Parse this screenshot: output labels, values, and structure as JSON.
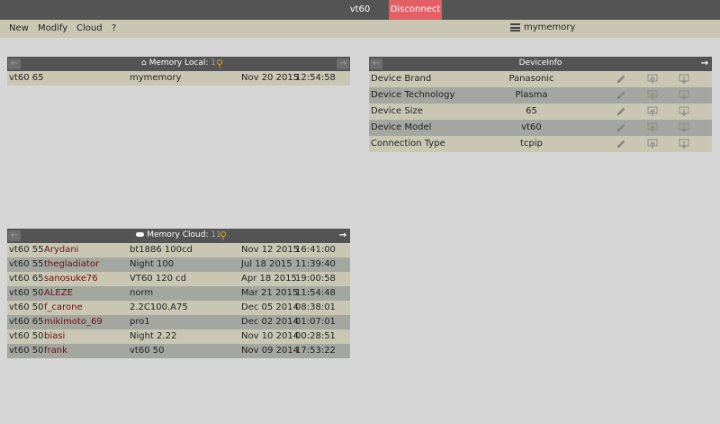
{
  "window": {
    "title": "vt60",
    "disconnect_label": "Disconnect"
  },
  "menu": {
    "items": [
      "New",
      "Modify",
      "Cloud",
      "?"
    ],
    "memory_name": "mymemory"
  },
  "memory_local": {
    "title": "Memory Local:",
    "count": "1",
    "rows": [
      {
        "model": "vt60 65",
        "name": "mymemory",
        "date": "Nov 20 2015",
        "time": "12:54:58"
      }
    ]
  },
  "memory_cloud": {
    "title": "Memory Cloud:",
    "count": "11",
    "rows": [
      {
        "model": "vt60 55",
        "user": "Arydani",
        "name": "bt1886 100cd",
        "date": "Nov 12 2015",
        "time": "16:41:00"
      },
      {
        "model": "vt60 55",
        "user": "thegladiator",
        "name": "Night 100",
        "date": "Jul 18 2015",
        "time": "11:39:40"
      },
      {
        "model": "vt60 65",
        "user": "sanosuke76",
        "name": "VT60 120 cd",
        "date": "Apr 18 2015",
        "time": "19:00:58"
      },
      {
        "model": "vt60 50",
        "user": "ALEZE",
        "name": "norm",
        "date": "Mar 21 2015",
        "time": "11:54:48"
      },
      {
        "model": "vt60 50",
        "user": "f_carone",
        "name": "2.2C100.A75",
        "date": "Dec 05 2014",
        "time": "08:38:01"
      },
      {
        "model": "vt60 65",
        "user": "mikimoto_69",
        "name": "pro1",
        "date": "Dec 02 2014",
        "time": "01:07:01"
      },
      {
        "model": "vt60 50",
        "user": "biasi",
        "name": "Night 2.22",
        "date": "Nov 10 2014",
        "time": "00:28:51"
      },
      {
        "model": "vt60 50",
        "user": "frank",
        "name": "vt60 50",
        "date": "Nov 09 2014",
        "time": "17:53:22"
      }
    ]
  },
  "device_info": {
    "title": "DeviceInfo",
    "rows": [
      {
        "label": "Device Brand",
        "value": "Panasonic"
      },
      {
        "label": "Device Technology",
        "value": "Plasma"
      },
      {
        "label": "Device Size",
        "value": "65"
      },
      {
        "label": "Device Model",
        "value": "vt60"
      },
      {
        "label": "Connection Type",
        "value": "tcpip"
      }
    ]
  },
  "icons": {
    "back": "arrow-left-icon",
    "forward": "arrow-right-icon",
    "search": "magnifier-icon",
    "home": "home-icon",
    "cloud": "cloud-icon",
    "edit": "pencil-icon",
    "upload": "upload-icon",
    "download": "download-icon",
    "menu": "hamburger-icon"
  },
  "colors": {
    "titlebar": "#545454",
    "disconnect": "#e45e66",
    "menubar": "#c9c7b3",
    "row_light": "#c9c7b3",
    "row_dark": "#a3a7a0",
    "username": "#6b0e13",
    "search_accent": "#f3a400",
    "background": "#d6d6d6"
  }
}
